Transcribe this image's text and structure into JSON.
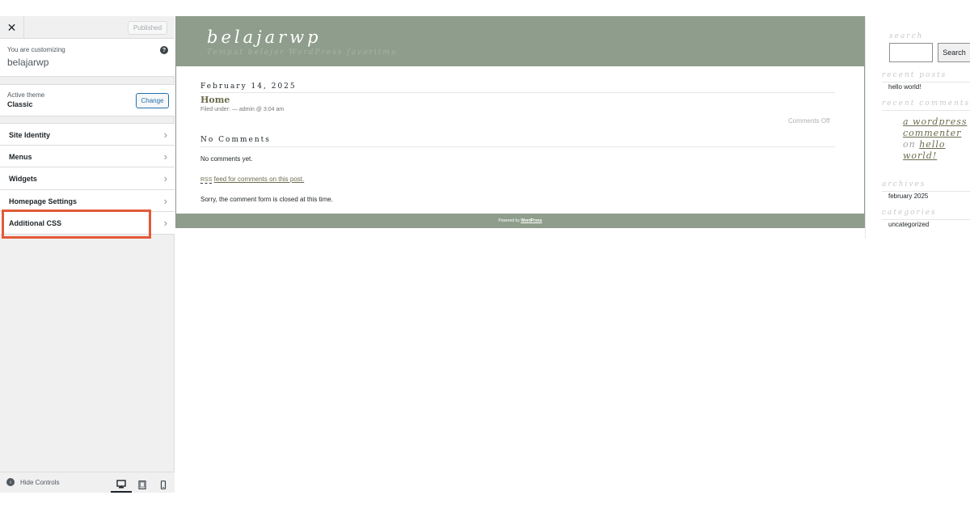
{
  "customizer": {
    "close_glyph": "✕",
    "publish_label": "Published",
    "customizing_label": "You are customizing",
    "site_name": "belajarwp",
    "help_glyph": "?",
    "active_theme_label": "Active theme",
    "theme_name": "Classic",
    "change_label": "Change",
    "menu": [
      {
        "label": "Site Identity"
      },
      {
        "label": "Menus"
      },
      {
        "label": "Widgets"
      },
      {
        "label": "Homepage Settings"
      },
      {
        "label": "Additional CSS"
      }
    ],
    "highlighted_item": "Additional CSS",
    "highlight_color": "#e25a38",
    "chevron_glyph": "›",
    "hide_controls_label": "Hide Controls",
    "hide_glyph": "‹",
    "devices": [
      {
        "icon": "desktop-icon",
        "active": true
      },
      {
        "icon": "tablet-icon",
        "active": false
      },
      {
        "icon": "mobile-icon",
        "active": false
      }
    ]
  },
  "preview": {
    "site_title": "belajarwp",
    "tagline": "Tempat belajar WordPress favoritmu",
    "header_color": "#8f9e8c",
    "post": {
      "date": "February 14, 2025",
      "title": "Home",
      "meta": "Filed under: — admin @ 3:04 am",
      "comments_status": "Comments Off",
      "comments_heading": "No Comments",
      "no_comments_text": "No comments yet.",
      "rss_abbr": "RSS",
      "rss_text": "feed for comments on this post.",
      "closed_text": "Sorry, the comment form is closed at this time."
    },
    "footer": {
      "powered_text": "Powered by",
      "powered_link": "WordPress"
    }
  },
  "widgets": {
    "search_heading": "search",
    "search_button": "Search",
    "recent_posts_heading": "recent posts",
    "recent_posts": [
      "hello world!"
    ],
    "recent_comments_heading": "recent comments",
    "commenter_link": "a wordpress commenter",
    "on_word": "on",
    "comment_post_link": "hello world!",
    "archives_heading": "archives",
    "archives": [
      "february 2025"
    ],
    "categories_heading": "categories",
    "categories": [
      "uncategorized"
    ]
  }
}
